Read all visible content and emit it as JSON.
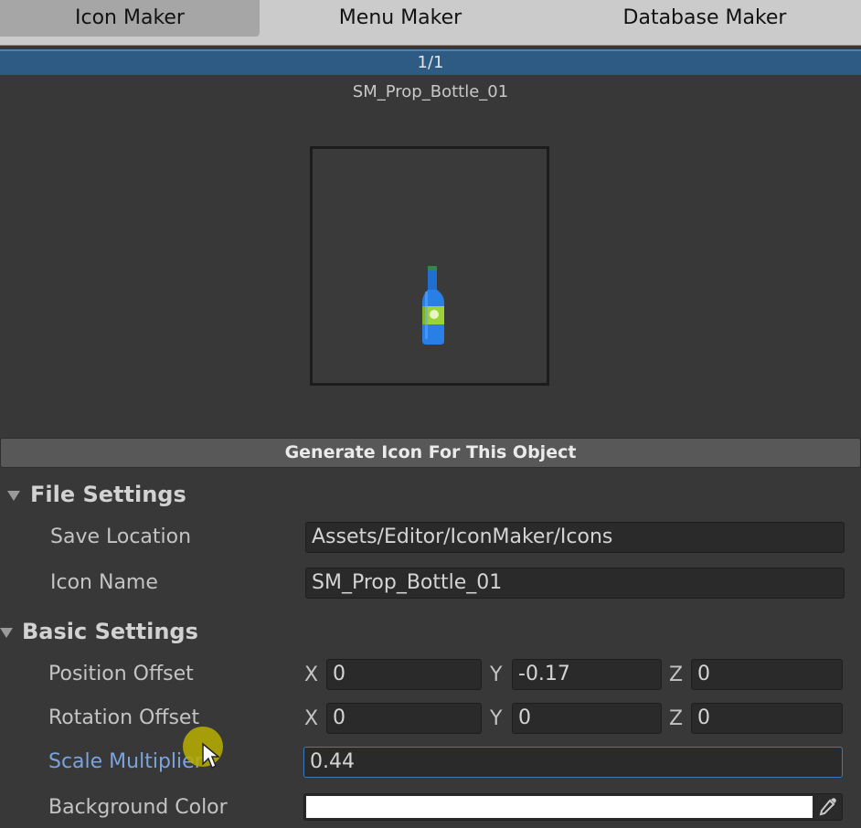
{
  "tabs": [
    {
      "label": "Icon Maker",
      "active": true
    },
    {
      "label": "Menu Maker",
      "active": false
    },
    {
      "label": "Database Maker",
      "active": false
    }
  ],
  "pager": "1/1",
  "object_name": "SM_Prop_Bottle_01",
  "generate_button": "Generate Icon For This Object",
  "file_settings": {
    "title": "File Settings",
    "save_location_label": "Save Location",
    "save_location_value": "Assets/Editor/IconMaker/Icons",
    "icon_name_label": "Icon Name",
    "icon_name_value": "SM_Prop_Bottle_01"
  },
  "basic_settings": {
    "title": "Basic Settings",
    "position_label": "Position Offset",
    "position": {
      "x_label": "X",
      "x": "0",
      "y_label": "Y",
      "y": "-0.17",
      "z_label": "Z",
      "z": "0"
    },
    "rotation_label": "Rotation Offset",
    "rotation": {
      "x_label": "X",
      "x": "0",
      "y_label": "Y",
      "y": "0",
      "z_label": "Z",
      "z": "0"
    },
    "scale_label": "Scale Multiplier",
    "scale_value": "0.44",
    "background_label": "Background Color",
    "background_color": "#ffffff"
  },
  "icons": {
    "triangle": "foldout-triangle-icon",
    "eyedropper": "eyedropper-icon",
    "bottle": "bottle-icon"
  },
  "colors": {
    "accent": "#2d5b83",
    "focus_label": "#7aa3e0",
    "focus_border": "#3a79bb"
  }
}
